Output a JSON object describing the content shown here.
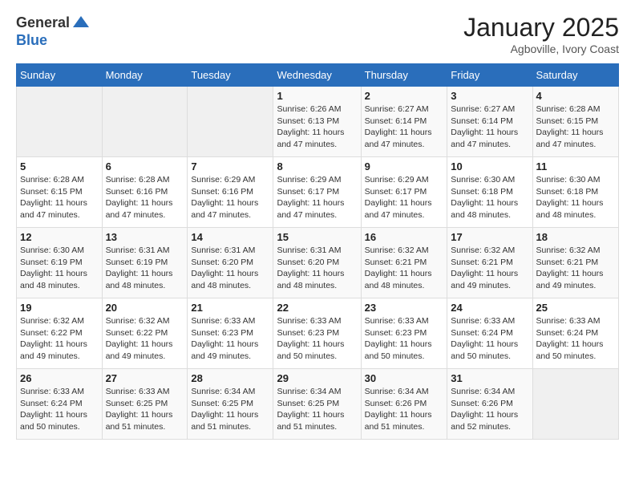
{
  "header": {
    "logo_general": "General",
    "logo_blue": "Blue",
    "month_title": "January 2025",
    "subtitle": "Agboville, Ivory Coast"
  },
  "days_of_week": [
    "Sunday",
    "Monday",
    "Tuesday",
    "Wednesday",
    "Thursday",
    "Friday",
    "Saturday"
  ],
  "weeks": [
    [
      {
        "day": "",
        "info": ""
      },
      {
        "day": "",
        "info": ""
      },
      {
        "day": "",
        "info": ""
      },
      {
        "day": "1",
        "info": "Sunrise: 6:26 AM\nSunset: 6:13 PM\nDaylight: 11 hours and 47 minutes."
      },
      {
        "day": "2",
        "info": "Sunrise: 6:27 AM\nSunset: 6:14 PM\nDaylight: 11 hours and 47 minutes."
      },
      {
        "day": "3",
        "info": "Sunrise: 6:27 AM\nSunset: 6:14 PM\nDaylight: 11 hours and 47 minutes."
      },
      {
        "day": "4",
        "info": "Sunrise: 6:28 AM\nSunset: 6:15 PM\nDaylight: 11 hours and 47 minutes."
      }
    ],
    [
      {
        "day": "5",
        "info": "Sunrise: 6:28 AM\nSunset: 6:15 PM\nDaylight: 11 hours and 47 minutes."
      },
      {
        "day": "6",
        "info": "Sunrise: 6:28 AM\nSunset: 6:16 PM\nDaylight: 11 hours and 47 minutes."
      },
      {
        "day": "7",
        "info": "Sunrise: 6:29 AM\nSunset: 6:16 PM\nDaylight: 11 hours and 47 minutes."
      },
      {
        "day": "8",
        "info": "Sunrise: 6:29 AM\nSunset: 6:17 PM\nDaylight: 11 hours and 47 minutes."
      },
      {
        "day": "9",
        "info": "Sunrise: 6:29 AM\nSunset: 6:17 PM\nDaylight: 11 hours and 47 minutes."
      },
      {
        "day": "10",
        "info": "Sunrise: 6:30 AM\nSunset: 6:18 PM\nDaylight: 11 hours and 48 minutes."
      },
      {
        "day": "11",
        "info": "Sunrise: 6:30 AM\nSunset: 6:18 PM\nDaylight: 11 hours and 48 minutes."
      }
    ],
    [
      {
        "day": "12",
        "info": "Sunrise: 6:30 AM\nSunset: 6:19 PM\nDaylight: 11 hours and 48 minutes."
      },
      {
        "day": "13",
        "info": "Sunrise: 6:31 AM\nSunset: 6:19 PM\nDaylight: 11 hours and 48 minutes."
      },
      {
        "day": "14",
        "info": "Sunrise: 6:31 AM\nSunset: 6:20 PM\nDaylight: 11 hours and 48 minutes."
      },
      {
        "day": "15",
        "info": "Sunrise: 6:31 AM\nSunset: 6:20 PM\nDaylight: 11 hours and 48 minutes."
      },
      {
        "day": "16",
        "info": "Sunrise: 6:32 AM\nSunset: 6:21 PM\nDaylight: 11 hours and 48 minutes."
      },
      {
        "day": "17",
        "info": "Sunrise: 6:32 AM\nSunset: 6:21 PM\nDaylight: 11 hours and 49 minutes."
      },
      {
        "day": "18",
        "info": "Sunrise: 6:32 AM\nSunset: 6:21 PM\nDaylight: 11 hours and 49 minutes."
      }
    ],
    [
      {
        "day": "19",
        "info": "Sunrise: 6:32 AM\nSunset: 6:22 PM\nDaylight: 11 hours and 49 minutes."
      },
      {
        "day": "20",
        "info": "Sunrise: 6:32 AM\nSunset: 6:22 PM\nDaylight: 11 hours and 49 minutes."
      },
      {
        "day": "21",
        "info": "Sunrise: 6:33 AM\nSunset: 6:23 PM\nDaylight: 11 hours and 49 minutes."
      },
      {
        "day": "22",
        "info": "Sunrise: 6:33 AM\nSunset: 6:23 PM\nDaylight: 11 hours and 50 minutes."
      },
      {
        "day": "23",
        "info": "Sunrise: 6:33 AM\nSunset: 6:23 PM\nDaylight: 11 hours and 50 minutes."
      },
      {
        "day": "24",
        "info": "Sunrise: 6:33 AM\nSunset: 6:24 PM\nDaylight: 11 hours and 50 minutes."
      },
      {
        "day": "25",
        "info": "Sunrise: 6:33 AM\nSunset: 6:24 PM\nDaylight: 11 hours and 50 minutes."
      }
    ],
    [
      {
        "day": "26",
        "info": "Sunrise: 6:33 AM\nSunset: 6:24 PM\nDaylight: 11 hours and 50 minutes."
      },
      {
        "day": "27",
        "info": "Sunrise: 6:33 AM\nSunset: 6:25 PM\nDaylight: 11 hours and 51 minutes."
      },
      {
        "day": "28",
        "info": "Sunrise: 6:34 AM\nSunset: 6:25 PM\nDaylight: 11 hours and 51 minutes."
      },
      {
        "day": "29",
        "info": "Sunrise: 6:34 AM\nSunset: 6:25 PM\nDaylight: 11 hours and 51 minutes."
      },
      {
        "day": "30",
        "info": "Sunrise: 6:34 AM\nSunset: 6:26 PM\nDaylight: 11 hours and 51 minutes."
      },
      {
        "day": "31",
        "info": "Sunrise: 6:34 AM\nSunset: 6:26 PM\nDaylight: 11 hours and 52 minutes."
      },
      {
        "day": "",
        "info": ""
      }
    ]
  ]
}
